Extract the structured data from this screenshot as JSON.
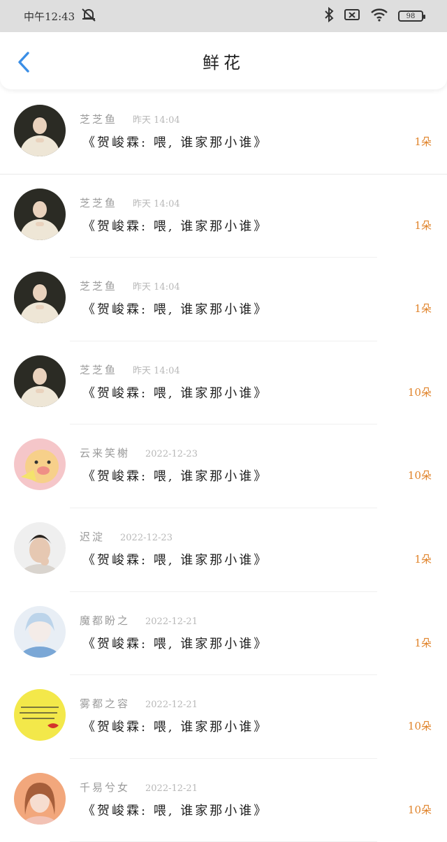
{
  "status_bar": {
    "time": "中午12:43",
    "battery": "98",
    "icons": [
      "mute-icon",
      "bluetooth-icon",
      "sim-icon",
      "wifi-icon",
      "battery-icon"
    ]
  },
  "header": {
    "title": "鲜花",
    "back_icon": "chevron-left-icon"
  },
  "colors": {
    "accent": "#3a8ee6",
    "count": "#e0832a",
    "meta": "#9a9a9a"
  },
  "records": [
    {
      "name": "芝芝鱼",
      "time": "昨天 14:04",
      "message": "《贺峻霖: 喂, 谁家那小谁》",
      "count": "1朵",
      "avatar": "boy-hoodie"
    },
    {
      "name": "芝芝鱼",
      "time": "昨天 14:04",
      "message": "《贺峻霖: 喂, 谁家那小谁》",
      "count": "1朵",
      "avatar": "boy-hoodie"
    },
    {
      "name": "芝芝鱼",
      "time": "昨天 14:04",
      "message": "《贺峻霖: 喂, 谁家那小谁》",
      "count": "1朵",
      "avatar": "boy-hoodie"
    },
    {
      "name": "芝芝鱼",
      "time": "昨天 14:04",
      "message": "《贺峻霖: 喂, 谁家那小谁》",
      "count": "10朵",
      "avatar": "boy-hoodie"
    },
    {
      "name": "云来笑榭",
      "time": "2022-12-23",
      "message": "《贺峻霖: 喂, 谁家那小谁》",
      "count": "10朵",
      "avatar": "cartoon-pig"
    },
    {
      "name": "迟淀",
      "time": "2022-12-23",
      "message": "《贺峻霖: 喂, 谁家那小谁》",
      "count": "1朵",
      "avatar": "boy-portrait"
    },
    {
      "name": "魔都盼之",
      "time": "2022-12-21",
      "message": "《贺峻霖: 喂, 谁家那小谁》",
      "count": "1朵",
      "avatar": "anime-boy"
    },
    {
      "name": "雾都之容",
      "time": "2022-12-21",
      "message": "《贺峻霖: 喂, 谁家那小谁》",
      "count": "10朵",
      "avatar": "yellow-note"
    },
    {
      "name": "千易兮女",
      "time": "2022-12-21",
      "message": "《贺峻霖: 喂, 谁家那小谁》",
      "count": "10朵",
      "avatar": "girl-portrait"
    }
  ]
}
